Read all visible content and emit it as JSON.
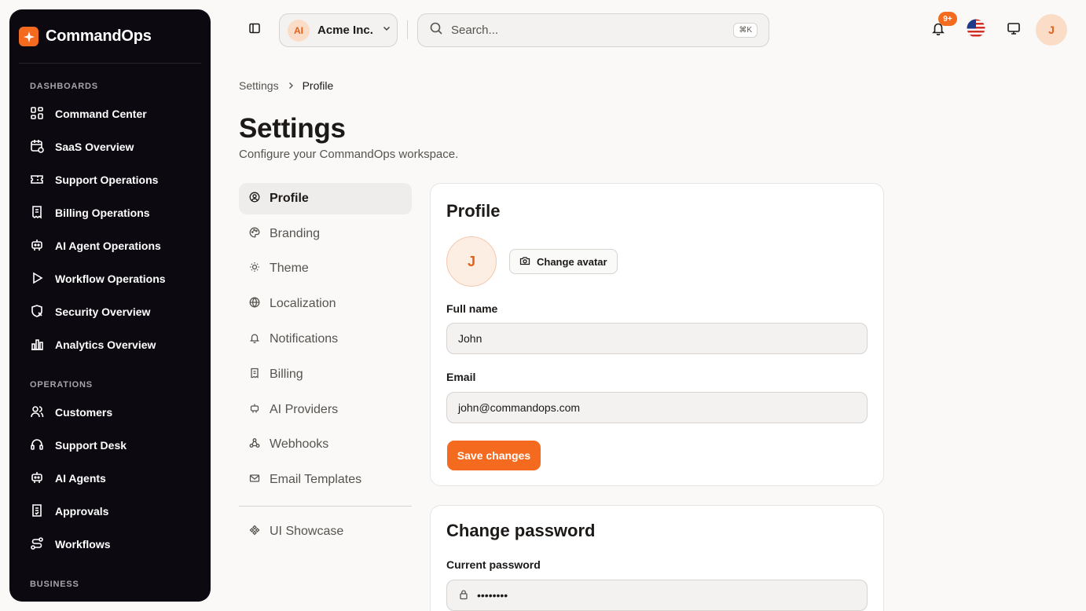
{
  "brand": {
    "name": "CommandOps"
  },
  "sidebar": {
    "sections": [
      {
        "label": "DASHBOARDS",
        "items": [
          {
            "label": "Command Center",
            "icon": "dashboard-grid-icon"
          },
          {
            "label": "SaaS Overview",
            "icon": "calendar-clock-icon"
          },
          {
            "label": "Support Operations",
            "icon": "ticket-icon"
          },
          {
            "label": "Billing Operations",
            "icon": "receipt-icon"
          },
          {
            "label": "AI Agent Operations",
            "icon": "bot-icon"
          },
          {
            "label": "Workflow Operations",
            "icon": "play-icon"
          },
          {
            "label": "Security Overview",
            "icon": "shield-x-icon"
          },
          {
            "label": "Analytics Overview",
            "icon": "bar-chart-icon"
          }
        ]
      },
      {
        "label": "OPERATIONS",
        "items": [
          {
            "label": "Customers",
            "icon": "users-icon"
          },
          {
            "label": "Support Desk",
            "icon": "headset-icon"
          },
          {
            "label": "AI Agents",
            "icon": "bot-icon"
          },
          {
            "label": "Approvals",
            "icon": "clipboard-check-icon"
          },
          {
            "label": "Workflows",
            "icon": "route-icon"
          }
        ]
      },
      {
        "label": "BUSINESS",
        "items": []
      }
    ]
  },
  "topbar": {
    "org": {
      "initials": "AI",
      "name": "Acme Inc."
    },
    "search": {
      "placeholder": "Search...",
      "shortcut": "⌘K"
    },
    "notifications": {
      "badge": "9+"
    },
    "user": {
      "initial": "J"
    }
  },
  "breadcrumb": {
    "parent": "Settings",
    "current": "Profile"
  },
  "page": {
    "title": "Settings",
    "subtitle": "Configure your CommandOps workspace."
  },
  "settings_nav": {
    "items": [
      {
        "label": "Profile",
        "icon": "user-circle-icon",
        "active": true
      },
      {
        "label": "Branding",
        "icon": "palette-icon"
      },
      {
        "label": "Theme",
        "icon": "sun-icon"
      },
      {
        "label": "Localization",
        "icon": "globe-icon"
      },
      {
        "label": "Notifications",
        "icon": "bell-icon"
      },
      {
        "label": "Billing",
        "icon": "receipt-icon"
      },
      {
        "label": "AI Providers",
        "icon": "bot-icon"
      },
      {
        "label": "Webhooks",
        "icon": "webhook-icon"
      },
      {
        "label": "Email Templates",
        "icon": "mail-icon"
      }
    ],
    "extra": {
      "label": "UI Showcase",
      "icon": "component-icon"
    }
  },
  "profile_card": {
    "title": "Profile",
    "avatar_initial": "J",
    "change_avatar_label": "Change avatar",
    "full_name_label": "Full name",
    "full_name_value": "John",
    "email_label": "Email",
    "email_value": "john@commandops.com",
    "save_label": "Save changes"
  },
  "password_card": {
    "title": "Change password",
    "current_label": "Current password",
    "current_value": "••••••••"
  },
  "colors": {
    "accent": "#f46a1f",
    "sidebar_bg": "#0c0a10",
    "page_bg": "#faf9f8"
  }
}
